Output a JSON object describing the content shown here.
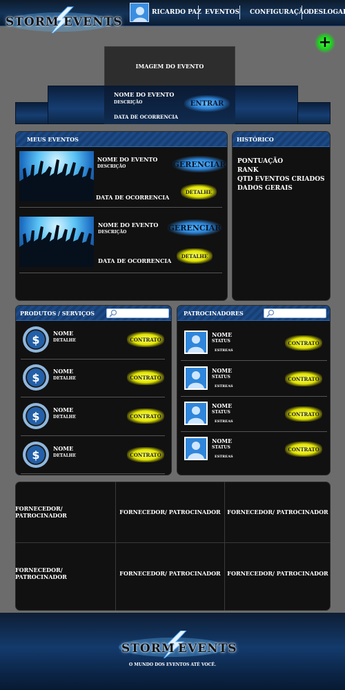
{
  "brand": {
    "left": "STORM",
    "right": "EVENTS",
    "tagline": "O MUNDO DOS EVENTOS ATÉ VOCÊ."
  },
  "nav": {
    "user": "RICARDO PAZ",
    "items": [
      "EVENTOS",
      "CONFIGURAÇÃO",
      "DESLOGAR"
    ]
  },
  "hero": {
    "image_label": "IMAGEM DO EVENTO",
    "name": "NOME DO EVENTO",
    "description": "DESCRIÇÃO",
    "date": "DATA DE OCORRENCIA",
    "enter": "ENTRAR"
  },
  "my_events": {
    "title": "MEUS EVENTOS",
    "items": [
      {
        "name": "NOME DO EVENTO",
        "description": "DESCRIÇÃO",
        "date": "DATA DE OCORRENCIA",
        "manage": "GERENCIAR",
        "detail": "DETALHE"
      },
      {
        "name": "NOME DO EVENTO",
        "description": "DESCRIÇÃO",
        "date": "DATA DE OCORRENCIA",
        "manage": "GERENCIAR",
        "detail": "DETALHE"
      }
    ]
  },
  "history": {
    "title": "HISTÓRICO",
    "lines": [
      "PONTUAÇÃO",
      "RANK",
      "QTD EVENTOS CRIADOS",
      "DADOS GERAIS"
    ]
  },
  "products": {
    "title": "PRODUTOS / SERVIÇOS",
    "items": [
      {
        "name": "NOME",
        "detail": "DETALHE",
        "action": "CONTRATO"
      },
      {
        "name": "NOME",
        "detail": "DETALHE",
        "action": "CONTRATO"
      },
      {
        "name": "NOME",
        "detail": "DETALHE",
        "action": "CONTRATO"
      },
      {
        "name": "NOME",
        "detail": "DETALHE",
        "action": "CONTRATO"
      }
    ]
  },
  "sponsors": {
    "title": "PATROCINADORES",
    "items": [
      {
        "name": "NOME",
        "status": "STATUS",
        "stars": "ESTREAS",
        "action": "CONTRATO"
      },
      {
        "name": "NOME",
        "status": "STATUS",
        "stars": "ESTREAS",
        "action": "CONTRATO"
      },
      {
        "name": "NOME",
        "status": "STATUS",
        "stars": "ESTREAS",
        "action": "CONTRATO"
      },
      {
        "name": "NOME",
        "status": "STATUS",
        "stars": "ESTREAS",
        "action": "CONTRATO"
      }
    ]
  },
  "suppliers": [
    "FORNECEDOR/ PATROCINADOR",
    "FORNECEDOR/ PATROCINADOR",
    "FORNECEDOR/ PATROCINADOR",
    "FORNECEDOR/ PATROCINADOR",
    "FORNECEDOR/ PATROCINADOR",
    "FORNECEDOR/ PATROCINADOR"
  ],
  "icons": {
    "add": "+",
    "dollar": "$"
  },
  "colors": {
    "accent_blue": "#1c4a86",
    "button_yellow": "#e2e400",
    "add_green": "#1fcf1f"
  }
}
